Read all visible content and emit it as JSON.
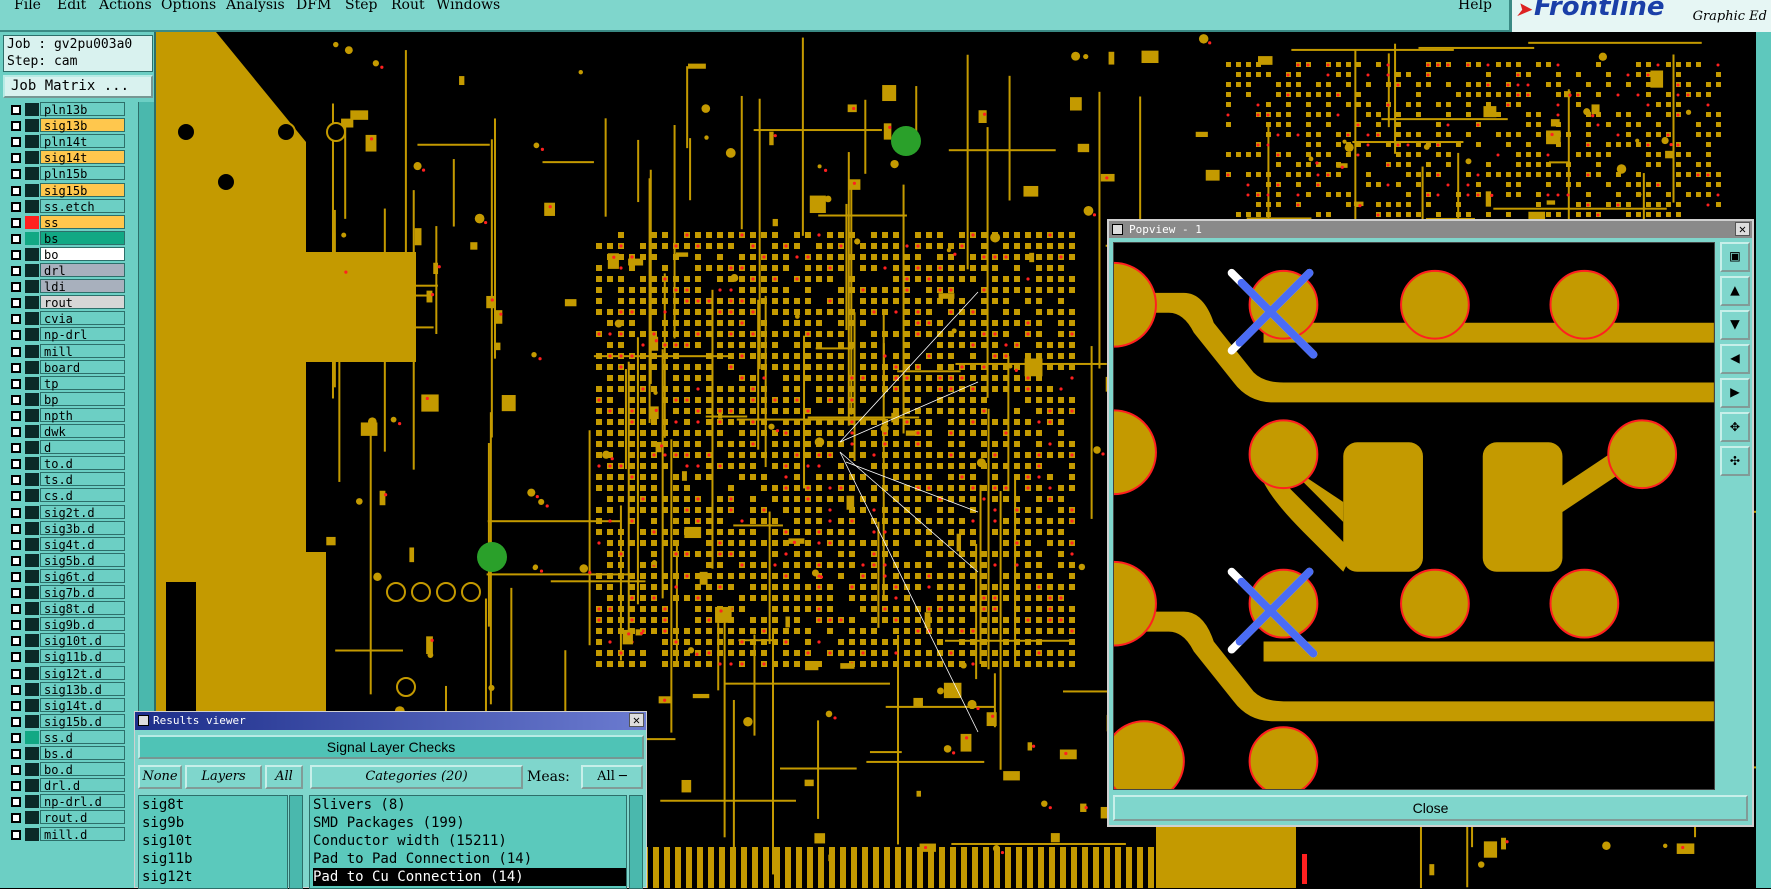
{
  "menu": {
    "items": [
      "File",
      "Edit",
      "Actions",
      "Options",
      "Analysis",
      "DFM",
      "Step",
      "Rout",
      "Windows"
    ],
    "help": "Help"
  },
  "logo": {
    "brand": "Frontline",
    "subtitle": "Graphic Ed"
  },
  "job": {
    "job_line": "Job : gv2pu003a0",
    "step_line": "Step: cam",
    "matrix_button": "Job Matrix ..."
  },
  "layers": [
    {
      "name": "pln13b",
      "color": "#6ccfc4"
    },
    {
      "name": "sig13b",
      "color": "#ffc74d"
    },
    {
      "name": "pln14t",
      "color": "#6ccfc4"
    },
    {
      "name": "sig14t",
      "color": "#ffc74d"
    },
    {
      "name": "pln15b",
      "color": "#6ccfc4"
    },
    {
      "name": "sig15b",
      "color": "#ffc74d"
    },
    {
      "name": "ss.etch",
      "color": "#6ccfc4"
    },
    {
      "name": "ss",
      "color": "#ffc74d"
    },
    {
      "name": "bs",
      "color": "#12a884"
    },
    {
      "name": "bo",
      "color": "#ffffff"
    },
    {
      "name": "drl",
      "color": "#a8b0bd"
    },
    {
      "name": "ldi",
      "color": "#a8b0bd"
    },
    {
      "name": "rout",
      "color": "#d6d6d6"
    },
    {
      "name": "cvia",
      "color": "#6ccfc4"
    },
    {
      "name": "np-drl",
      "color": "#6ccfc4"
    },
    {
      "name": "mill",
      "color": "#6ccfc4"
    },
    {
      "name": "board",
      "color": "#6ccfc4"
    },
    {
      "name": "tp",
      "color": "#6ccfc4"
    },
    {
      "name": "bp",
      "color": "#6ccfc4"
    },
    {
      "name": "npth",
      "color": "#6ccfc4"
    },
    {
      "name": "dwk",
      "color": "#6ccfc4"
    },
    {
      "name": "d",
      "color": "#6ccfc4"
    },
    {
      "name": "to.d",
      "color": "#6ccfc4"
    },
    {
      "name": "ts.d",
      "color": "#6ccfc4"
    },
    {
      "name": "cs.d",
      "color": "#6ccfc4"
    },
    {
      "name": "sig2t.d",
      "color": "#6ccfc4"
    },
    {
      "name": "sig3b.d",
      "color": "#6ccfc4"
    },
    {
      "name": "sig4t.d",
      "color": "#6ccfc4"
    },
    {
      "name": "sig5b.d",
      "color": "#6ccfc4"
    },
    {
      "name": "sig6t.d",
      "color": "#6ccfc4"
    },
    {
      "name": "sig7b.d",
      "color": "#6ccfc4"
    },
    {
      "name": "sig8t.d",
      "color": "#6ccfc4"
    },
    {
      "name": "sig9b.d",
      "color": "#6ccfc4"
    },
    {
      "name": "sig10t.d",
      "color": "#6ccfc4"
    },
    {
      "name": "sig11b.d",
      "color": "#6ccfc4"
    },
    {
      "name": "sig12t.d",
      "color": "#6ccfc4"
    },
    {
      "name": "sig13b.d",
      "color": "#6ccfc4"
    },
    {
      "name": "sig14t.d",
      "color": "#6ccfc4"
    },
    {
      "name": "sig15b.d",
      "color": "#6ccfc4"
    },
    {
      "name": "ss.d",
      "color": "#6ccfc4"
    },
    {
      "name": "bs.d",
      "color": "#6ccfc4"
    },
    {
      "name": "bo.d",
      "color": "#6ccfc4"
    },
    {
      "name": "drl.d",
      "color": "#6ccfc4"
    },
    {
      "name": "np-drl.d",
      "color": "#6ccfc4"
    },
    {
      "name": "rout.d",
      "color": "#6ccfc4"
    },
    {
      "name": "mill.d",
      "color": "#6ccfc4"
    }
  ],
  "popview": {
    "title": "Popview - 1",
    "close_label": "Close"
  },
  "results": {
    "title": "Results viewer",
    "header": "Signal Layer Checks",
    "none_label": "None",
    "layers_label": "Layers",
    "all_label": "All",
    "categories_label": "Categories (20)",
    "meas_label": "Meas:",
    "meas_value": "All",
    "layer_list": [
      "sig8t",
      "sig9b",
      "sig10t",
      "sig11b",
      "sig12t"
    ],
    "category_list": [
      "Slivers (8)",
      "SMD Packages (199)",
      "Conductor width (15211)",
      "Pad to Pad Connection (14)",
      "Pad to Cu Connection (14)"
    ],
    "selected_category": 4
  },
  "colors": {
    "copper": "#c49a00",
    "board": "#000000",
    "pad_outline": "#ff2020",
    "ui_teal": "#7fd6cc",
    "marker_blue": "#4a6cf5"
  }
}
